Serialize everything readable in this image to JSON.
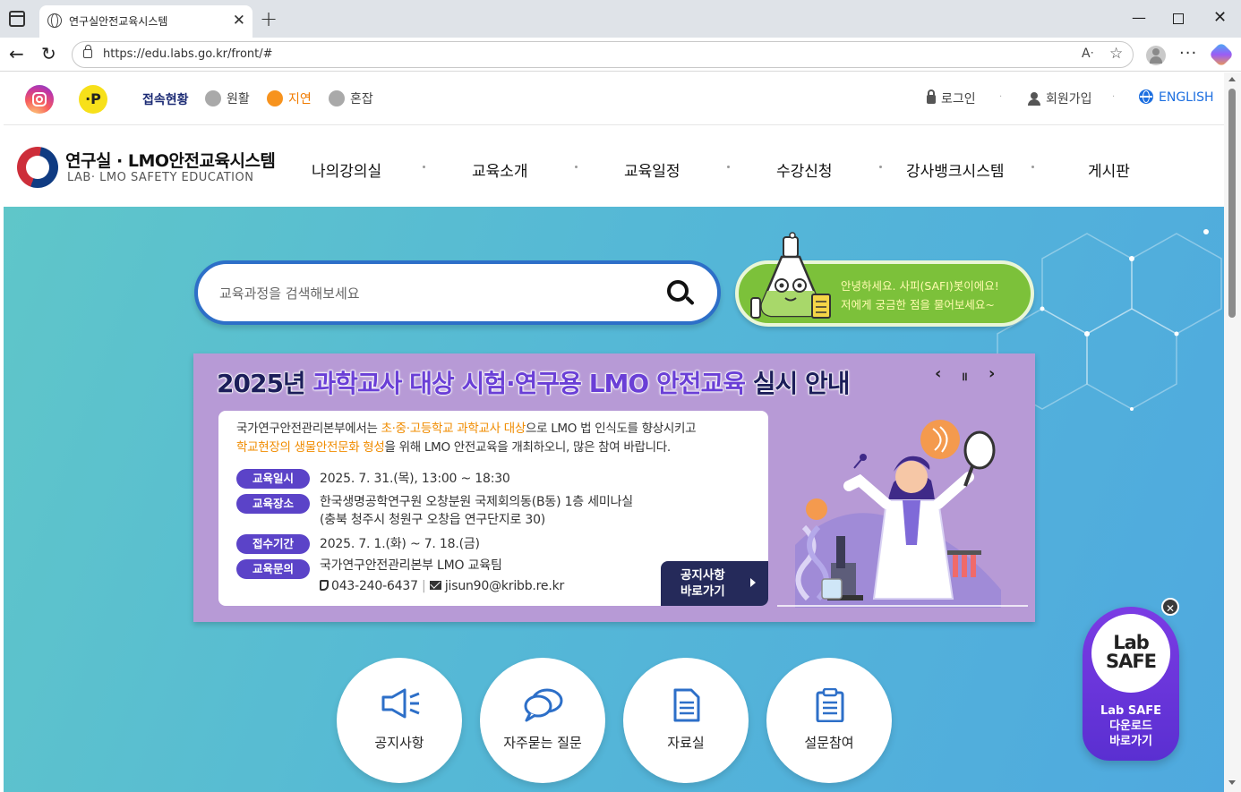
{
  "browser": {
    "tab_title": "연구실안전교육시스템",
    "tab_close": "✕",
    "new_tab": "+",
    "url": "https://edu.labs.go.kr/front/#",
    "read_aloud": "Aᐧ",
    "min": "—",
    "close": "✕",
    "back": "←",
    "reload": "↻",
    "more": "···",
    "star": "☆"
  },
  "utility": {
    "kakao_label": "·P",
    "status_label": "접속현황",
    "statuses": [
      {
        "label": "원활",
        "color": "#a9a9a9",
        "text_color": "#444444"
      },
      {
        "label": "지연",
        "color": "#f7931e",
        "text_color": "#f07b00"
      },
      {
        "label": "혼잡",
        "color": "#a9a9a9",
        "text_color": "#444444"
      }
    ],
    "login": "로그인",
    "signup": "회원가입",
    "english": "ENGLISH",
    "english_color": "#1d6fe0",
    "sep": "·"
  },
  "header": {
    "logo_title": "연구실 · LMO안전교육시스템",
    "logo_sub": "LAB· LMO SAFETY EDUCATION",
    "nav": [
      "나의강의실",
      "교육소개",
      "교육일정",
      "수강신청",
      "강사뱅크시스템",
      "게시판"
    ]
  },
  "search": {
    "placeholder": "교육과정을 검색해보세요"
  },
  "chatbot": {
    "line1": "안녕하세요. 사피(SAFI)봇이에요!",
    "line2": "저에게 궁금한 점을 물어보세요~"
  },
  "banner": {
    "title_a": "2025년 ",
    "title_hl": "과학교사 대상 시험·연구용 LMO 안전교육",
    "title_b": " 실시 안내",
    "prev": "‹",
    "pause": "॥",
    "next": "›",
    "intro_1a": "국가연구안전관리본부에서는 ",
    "intro_1hl": "초·중·고등학교 과학교사 대상",
    "intro_1b": "으로 LMO 법 인식도를 향상시키고",
    "intro_2hl": "학교현장의 생물안전문화 형성",
    "intro_2b": "을 위해 LMO 안전교육을 개최하오니, 많은 참여 바랍니다.",
    "rows": [
      {
        "label": "교육일시",
        "value": "2025. 7. 31.(목), 13:00 ~ 18:30"
      },
      {
        "label": "교육장소",
        "value": "한국생명공학연구원 오창분원 국제회의동(B동) 1층 세미나실",
        "value2": "(충북 청주시 청원구 오창읍 연구단지로 30)"
      },
      {
        "label": "접수기간",
        "value": "2025. 7. 1.(화) ~ 7. 18.(금)"
      },
      {
        "label": "교육문의",
        "value": "국가연구안전관리본부 LMO 교육팀"
      }
    ],
    "phone": "043-240-6437",
    "email": "jisun90@kribb.re.kr",
    "divider": "|",
    "notice_line1": "공지사항",
    "notice_line2": "바로가기"
  },
  "quick": [
    {
      "label": "공지사항",
      "icon": "megaphone-icon"
    },
    {
      "label": "자주묻는 질문",
      "icon": "chat-bubbles-icon"
    },
    {
      "label": "자료실",
      "icon": "document-icon"
    },
    {
      "label": "설문참여",
      "icon": "clipboard-icon"
    }
  ],
  "labsafe": {
    "logo_line1": "Lab",
    "logo_line2": "SAFE",
    "text_line1": "Lab SAFE",
    "text_line2": "다운로드",
    "text_line3": "바로가기",
    "close": "✕"
  },
  "colors": {
    "accent_blue": "#2d6fc8",
    "navy": "#1b2a74",
    "hero_teal": "#55b8d6",
    "banner_purple": "#b79ad6",
    "badge_purple": "#5b43c8",
    "chatbot_green": "#7cc13a"
  }
}
